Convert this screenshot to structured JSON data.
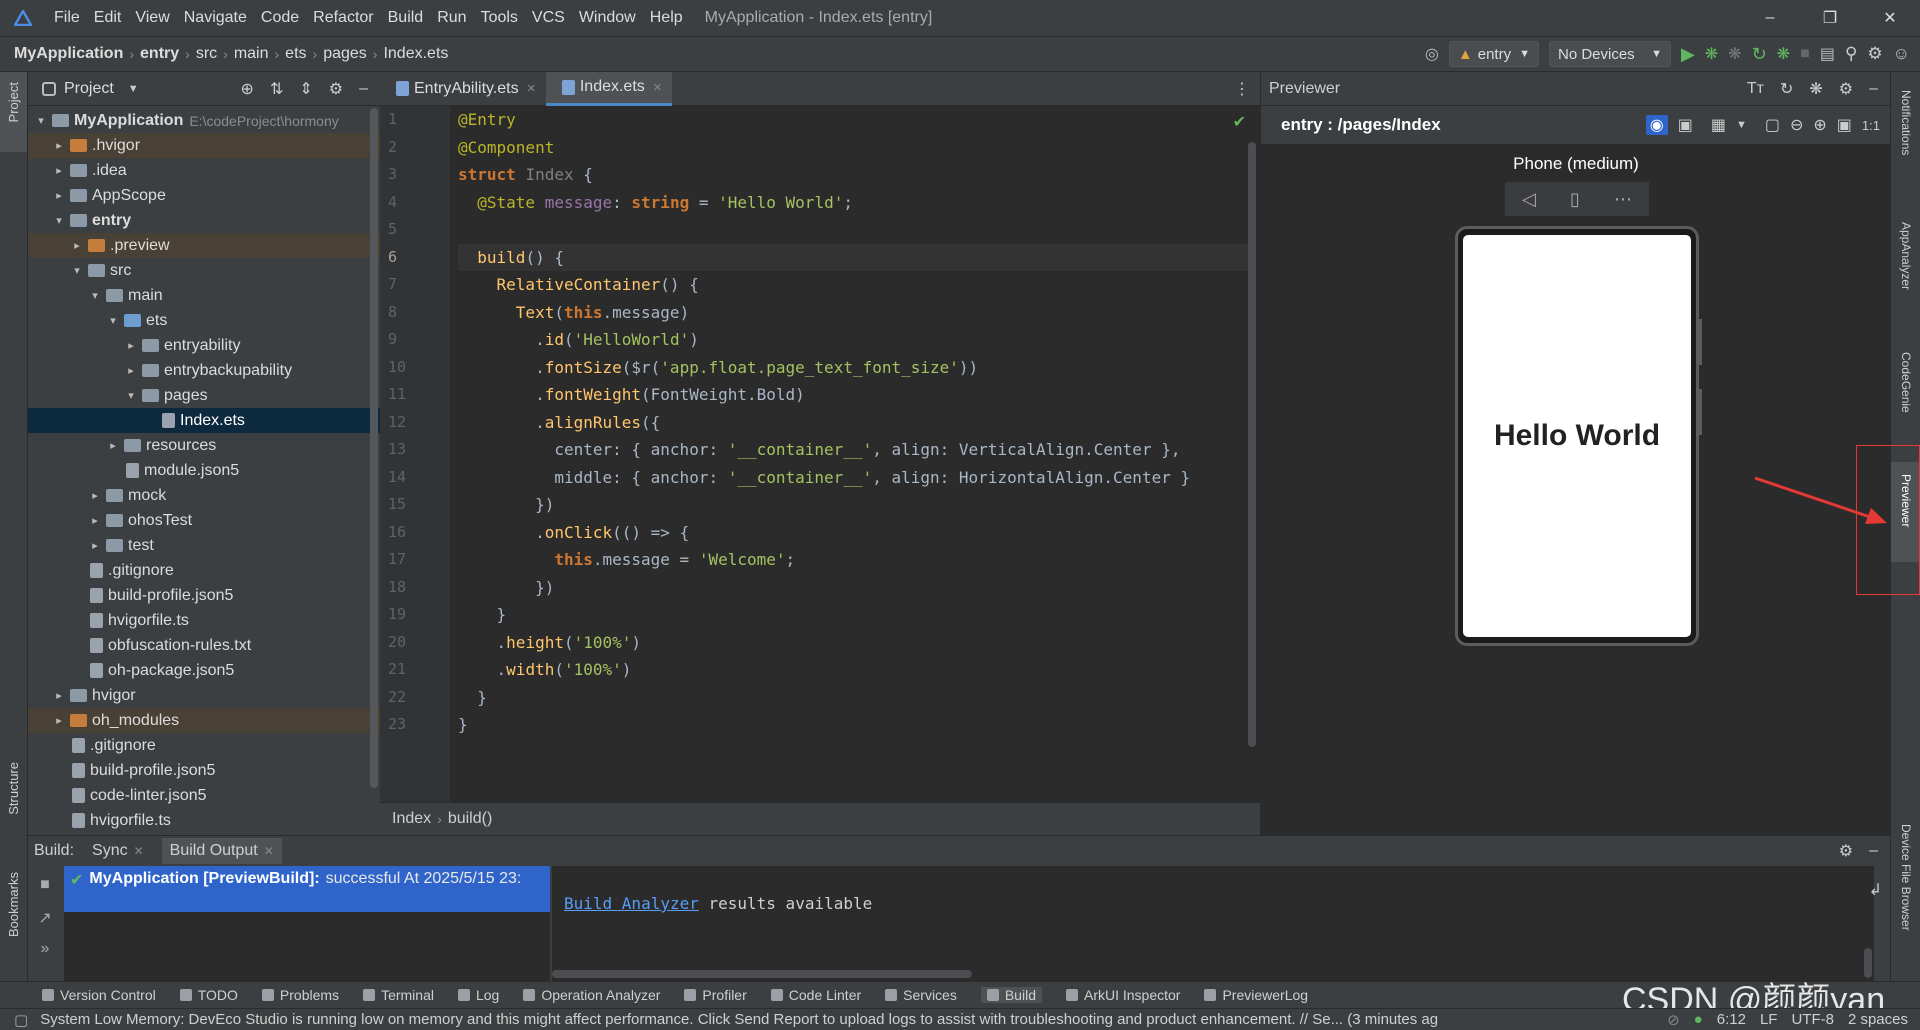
{
  "window": {
    "title": "MyApplication - Index.ets [entry]",
    "menu": [
      "File",
      "Edit",
      "View",
      "Navigate",
      "Code",
      "Refactor",
      "Build",
      "Run",
      "Tools",
      "VCS",
      "Window",
      "Help"
    ]
  },
  "breadcrumb": [
    "MyApplication",
    "entry",
    "src",
    "main",
    "ets",
    "pages",
    "Index.ets"
  ],
  "toolbar": {
    "module": "entry",
    "device": "No Devices"
  },
  "left_strip": {
    "project": "Project",
    "structure": "Structure",
    "bookmarks": "Bookmarks"
  },
  "project_panel": {
    "title": "Project",
    "tree": [
      {
        "label": "MyApplication",
        "path": "E:\\codeProject\\hormony",
        "level": 0,
        "arrow": "▾",
        "icon": "folder",
        "bold": true
      },
      {
        "label": ".hvigor",
        "level": 1,
        "arrow": "▸",
        "icon": "folder-orange",
        "hl": true
      },
      {
        "label": ".idea",
        "level": 1,
        "arrow": "▸",
        "icon": "folder"
      },
      {
        "label": "AppScope",
        "level": 1,
        "arrow": "▸",
        "icon": "folder"
      },
      {
        "label": "entry",
        "level": 1,
        "arrow": "▾",
        "icon": "folder",
        "bold": true
      },
      {
        "label": ".preview",
        "level": 2,
        "arrow": "▸",
        "icon": "folder-orange",
        "hl": true
      },
      {
        "label": "src",
        "level": 2,
        "arrow": "▾",
        "icon": "folder"
      },
      {
        "label": "main",
        "level": 3,
        "arrow": "▾",
        "icon": "folder"
      },
      {
        "label": "ets",
        "level": 4,
        "arrow": "▾",
        "icon": "folder-blue"
      },
      {
        "label": "entryability",
        "level": 5,
        "arrow": "▸",
        "icon": "folder"
      },
      {
        "label": "entrybackupability",
        "level": 5,
        "arrow": "▸",
        "icon": "folder"
      },
      {
        "label": "pages",
        "level": 5,
        "arrow": "▾",
        "icon": "folder"
      },
      {
        "label": "Index.ets",
        "level": 6,
        "arrow": "",
        "icon": "file",
        "sel": true
      },
      {
        "label": "resources",
        "level": 4,
        "arrow": "▸",
        "icon": "folder"
      },
      {
        "label": "module.json5",
        "level": 4,
        "arrow": "",
        "icon": "file"
      },
      {
        "label": "mock",
        "level": 3,
        "arrow": "▸",
        "icon": "folder"
      },
      {
        "label": "ohosTest",
        "level": 3,
        "arrow": "▸",
        "icon": "folder"
      },
      {
        "label": "test",
        "level": 3,
        "arrow": "▸",
        "icon": "folder"
      },
      {
        "label": ".gitignore",
        "level": 2,
        "arrow": "",
        "icon": "file"
      },
      {
        "label": "build-profile.json5",
        "level": 2,
        "arrow": "",
        "icon": "file"
      },
      {
        "label": "hvigorfile.ts",
        "level": 2,
        "arrow": "",
        "icon": "file"
      },
      {
        "label": "obfuscation-rules.txt",
        "level": 2,
        "arrow": "",
        "icon": "file"
      },
      {
        "label": "oh-package.json5",
        "level": 2,
        "arrow": "",
        "icon": "file"
      },
      {
        "label": "hvigor",
        "level": 1,
        "arrow": "▸",
        "icon": "folder"
      },
      {
        "label": "oh_modules",
        "level": 1,
        "arrow": "▸",
        "icon": "folder-orange",
        "hl": true
      },
      {
        "label": ".gitignore",
        "level": 1,
        "arrow": "",
        "icon": "file"
      },
      {
        "label": "build-profile.json5",
        "level": 1,
        "arrow": "",
        "icon": "file"
      },
      {
        "label": "code-linter.json5",
        "level": 1,
        "arrow": "",
        "icon": "file"
      },
      {
        "label": "hvigorfile.ts",
        "level": 1,
        "arrow": "",
        "icon": "file"
      }
    ]
  },
  "editor": {
    "tabs": [
      {
        "label": "EntryAbility.ets",
        "active": false
      },
      {
        "label": "Index.ets",
        "active": true
      }
    ],
    "line_numbers": [
      "1",
      "2",
      "3",
      "4",
      "5",
      "6",
      "7",
      "8",
      "9",
      "10",
      "11",
      "12",
      "13",
      "14",
      "15",
      "16",
      "17",
      "18",
      "19",
      "20",
      "21",
      "22",
      "23"
    ],
    "code_lines": [
      [
        [
          "an",
          "@Entry"
        ]
      ],
      [
        [
          "an",
          "@Component"
        ]
      ],
      [
        [
          "kw",
          "struct "
        ],
        [
          "gr",
          "Index "
        ],
        [
          "ty",
          "{"
        ]
      ],
      [
        [
          "ty",
          "  "
        ],
        [
          "an",
          "@State "
        ],
        [
          "me",
          "message"
        ],
        [
          "ty",
          ": "
        ],
        [
          "kw",
          "string "
        ],
        [
          "ty",
          "= "
        ],
        [
          "str2",
          "'Hello World'"
        ],
        [
          "ty",
          ";"
        ]
      ],
      [
        [
          "ty",
          ""
        ]
      ],
      [
        [
          "ty",
          "  "
        ],
        [
          "fn",
          "build"
        ],
        [
          "ty",
          "() {"
        ]
      ],
      [
        [
          "ty",
          "    "
        ],
        [
          "fn",
          "RelativeContainer"
        ],
        [
          "ty",
          "() {"
        ]
      ],
      [
        [
          "ty",
          "      "
        ],
        [
          "fn",
          "Text"
        ],
        [
          "ty",
          "("
        ],
        [
          "kw",
          "this"
        ],
        [
          "ty",
          ".message)"
        ]
      ],
      [
        [
          "ty",
          "        ."
        ],
        [
          "fn",
          "id"
        ],
        [
          "ty",
          "("
        ],
        [
          "str2",
          "'HelloWorld'"
        ],
        [
          "ty",
          ")"
        ]
      ],
      [
        [
          "ty",
          "        ."
        ],
        [
          "fn",
          "fontSize"
        ],
        [
          "ty",
          "($r("
        ],
        [
          "str2",
          "'app.float.page_text_font_size'"
        ],
        [
          "ty",
          "))"
        ]
      ],
      [
        [
          "ty",
          "        ."
        ],
        [
          "fn",
          "fontWeight"
        ],
        [
          "ty",
          "(FontWeight.Bold)"
        ]
      ],
      [
        [
          "ty",
          "        ."
        ],
        [
          "fn",
          "alignRules"
        ],
        [
          "ty",
          "({"
        ]
      ],
      [
        [
          "ty",
          "          center: { anchor: "
        ],
        [
          "str2",
          "'__container__'"
        ],
        [
          "ty",
          ", align: VerticalAlign.Center },"
        ]
      ],
      [
        [
          "ty",
          "          middle: { anchor: "
        ],
        [
          "str2",
          "'__container__'"
        ],
        [
          "ty",
          ", align: HorizontalAlign.Center }"
        ]
      ],
      [
        [
          "ty",
          "        })"
        ]
      ],
      [
        [
          "ty",
          "        ."
        ],
        [
          "fn",
          "onClick"
        ],
        [
          "ty",
          "(() => {"
        ]
      ],
      [
        [
          "ty",
          "          "
        ],
        [
          "kw",
          "this"
        ],
        [
          "ty",
          ".message = "
        ],
        [
          "str2",
          "'Welcome'"
        ],
        [
          "ty",
          ";"
        ]
      ],
      [
        [
          "ty",
          "        })"
        ]
      ],
      [
        [
          "ty",
          "    }"
        ]
      ],
      [
        [
          "ty",
          "    ."
        ],
        [
          "fn",
          "height"
        ],
        [
          "ty",
          "("
        ],
        [
          "str2",
          "'100%'"
        ],
        [
          "ty",
          ")"
        ]
      ],
      [
        [
          "ty",
          "    ."
        ],
        [
          "fn",
          "width"
        ],
        [
          "ty",
          "("
        ],
        [
          "str2",
          "'100%'"
        ],
        [
          "ty",
          ")"
        ]
      ],
      [
        [
          "ty",
          "  }"
        ]
      ],
      [
        [
          "ty",
          "}"
        ]
      ]
    ],
    "breadcrumb": [
      "Index",
      "build()"
    ]
  },
  "previewer": {
    "title": "Previewer",
    "route": "entry : /pages/Index",
    "device_name": "Phone (medium)",
    "screen_text": "Hello World"
  },
  "right_strip": [
    "Notifications",
    "AppAnalyzer",
    "CodeGenie",
    "Previewer",
    "Device File Browser"
  ],
  "build_panel": {
    "label": "Build:",
    "tabs": [
      "Sync",
      "Build Output"
    ],
    "entry_title": "MyApplication [PreviewBuild]:",
    "entry_status": "successful At 2025/5/15 23:",
    "link": "Build Analyzer",
    "message": " results available"
  },
  "tool_windows": [
    "Version Control",
    "TODO",
    "Problems",
    "Terminal",
    "Log",
    "Operation Analyzer",
    "Profiler",
    "Code Linter",
    "Services",
    "Build",
    "ArkUI Inspector",
    "PreviewerLog"
  ],
  "status": {
    "message": "System Low Memory: DevEco Studio is running low on memory and this might affect performance. Click Send Report to upload logs to assist with troubleshooting and product enhancement. // Se... (3 minutes ag",
    "position": "6:12",
    "line_sep": "LF",
    "encoding": "UTF-8",
    "indent": "2 spaces"
  },
  "watermark": "CSDN @颜颜yan_",
  "colors": {
    "accent": "#4a88c7",
    "annotation_red": "#e53935",
    "build_success": "#5fb85f"
  }
}
